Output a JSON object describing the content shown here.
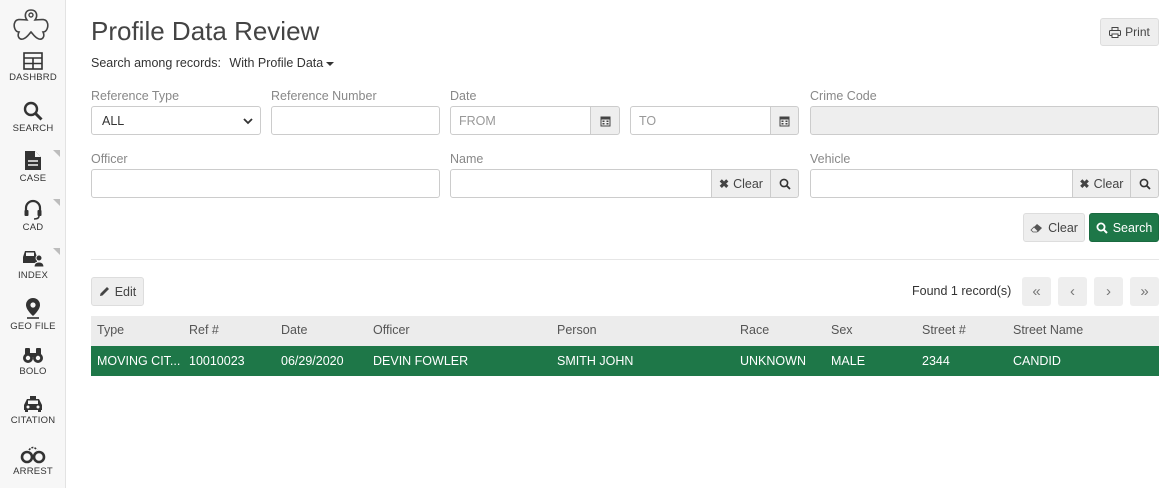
{
  "nav": [
    {
      "key": "dashboard",
      "label": "DASHBRD",
      "icon": "dashboard-icon"
    },
    {
      "key": "search",
      "label": "SEARCH",
      "icon": "search-icon"
    },
    {
      "key": "case",
      "label": "CASE",
      "icon": "file-icon"
    },
    {
      "key": "cad",
      "label": "CAD",
      "icon": "headset-icon"
    },
    {
      "key": "index",
      "label": "INDEX",
      "icon": "car-person-icon"
    },
    {
      "key": "geo-file",
      "label": "GEO FILE",
      "icon": "map-pin-icon"
    },
    {
      "key": "bolo",
      "label": "BOLO",
      "icon": "binoculars-icon"
    },
    {
      "key": "citation",
      "label": "CITATION",
      "icon": "car-icon"
    },
    {
      "key": "arrest",
      "label": "ARREST",
      "icon": "handcuffs-icon"
    }
  ],
  "page": {
    "title": "Profile Data Review",
    "print_label": "Print",
    "search_among_label": "Search among records:",
    "search_among_value": "With Profile Data"
  },
  "form": {
    "reference_type_label": "Reference Type",
    "reference_type_value": "ALL",
    "reference_number_label": "Reference Number",
    "reference_number_value": "",
    "date_label": "Date",
    "date_from_placeholder": "FROM",
    "date_to_placeholder": "TO",
    "crime_code_label": "Crime Code",
    "crime_code_value": "",
    "officer_label": "Officer",
    "officer_value": "",
    "name_label": "Name",
    "name_value": "",
    "vehicle_label": "Vehicle",
    "vehicle_value": "",
    "clear_addon_label": "Clear",
    "clear_button_label": "Clear",
    "search_button_label": "Search"
  },
  "results": {
    "edit_label": "Edit",
    "found_text": "Found 1 record(s)",
    "columns": [
      "Type",
      "Ref #",
      "Date",
      "Officer",
      "Person",
      "Race",
      "Sex",
      "Street #",
      "Street Name"
    ],
    "rows": [
      [
        "MOVING CIT...",
        "10010023",
        "06/29/2020",
        "DEVIN FOWLER",
        "SMITH JOHN",
        "UNKNOWN",
        "MALE",
        "2344",
        "CANDID"
      ]
    ]
  },
  "colors": {
    "accent": "#1e7748",
    "header_bg": "#ececec",
    "sidebar_bg": "#f7f7f7"
  }
}
